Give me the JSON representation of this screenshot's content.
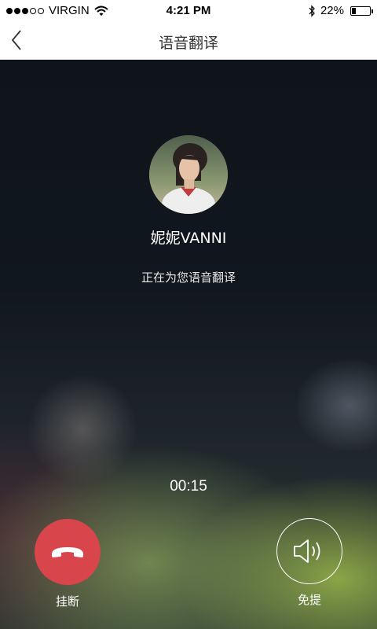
{
  "status_bar": {
    "carrier": "VIRGIN",
    "signal_bars": 3,
    "signal_total": 5,
    "time": "4:21 PM",
    "battery": "22%",
    "battery_level": 0.22,
    "icons": [
      "wifi-icon",
      "bluetooth-icon",
      "battery-icon"
    ]
  },
  "nav": {
    "title": "语音翻译",
    "back_icon": "chevron-left-icon"
  },
  "call": {
    "contact_name": "妮妮VANNI",
    "status": "正在为您语音翻译",
    "timer": "00:15"
  },
  "actions": {
    "hangup_label": "挂断",
    "hangup_icon": "phone-hangup-icon",
    "hangup_color": "#d8464b",
    "speaker_label": "免提",
    "speaker_icon": "speaker-icon"
  }
}
